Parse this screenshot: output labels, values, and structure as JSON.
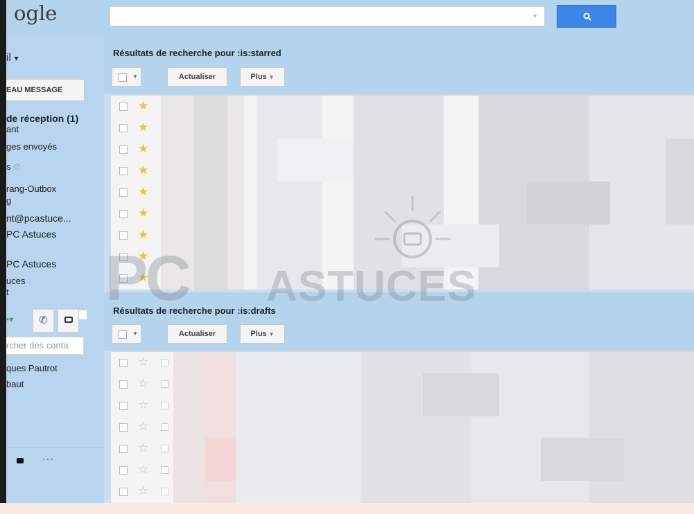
{
  "header": {
    "logo": "ogle",
    "search_value": ""
  },
  "sidebar": {
    "mail_label": "il",
    "compose_label": "EAU MESSAGE",
    "items": [
      "de réception (1)",
      "ant",
      "ges envoyés",
      "s",
      "rang-Outbox",
      "g",
      "nt@pcastuce...",
      "PC Astuces",
      "PC Astuces",
      "uces",
      "t"
    ],
    "contacts_placeholder": "rcher des conta",
    "contacts": [
      "ques Pautrot",
      "baut"
    ],
    "more_dots": "···"
  },
  "starred": {
    "title": "Résultats de recherche pour :is:starred",
    "refresh_label": "Actualiser",
    "more_label": "Plus"
  },
  "drafts": {
    "title": "Résultats de recherche pour :is:drafts",
    "refresh_label": "Actualiser",
    "more_label": "Plus"
  },
  "watermark": {
    "logo_text": "PC",
    "text": "ASTUCES"
  },
  "colors": {
    "accent": "#3c86e8",
    "star_on": "#f2c230",
    "header_bg": "#b4d3ec"
  }
}
